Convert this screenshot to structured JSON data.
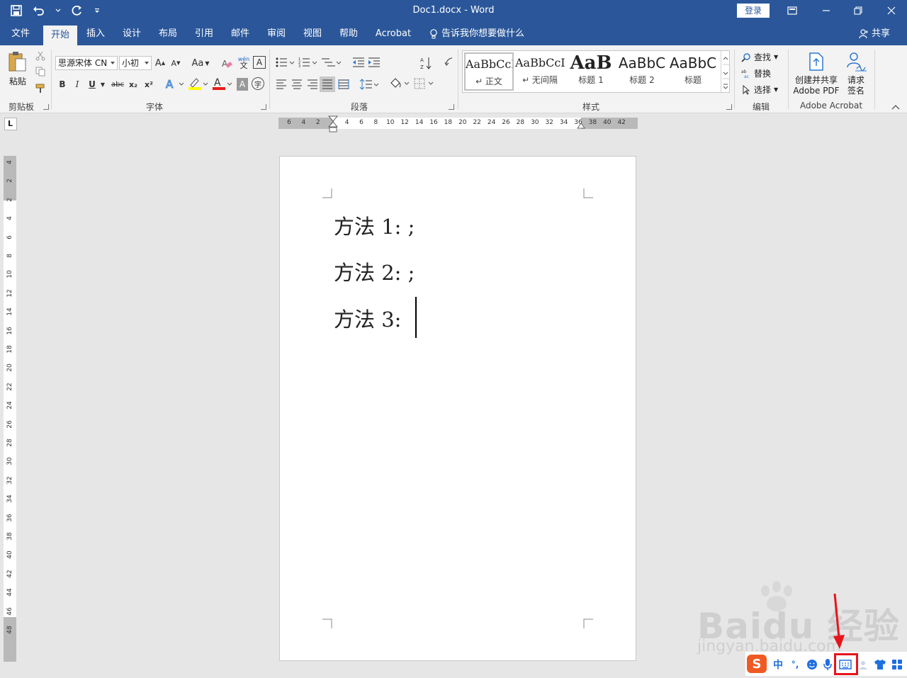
{
  "window": {
    "title": "Doc1.docx  -  Word",
    "login": "登录"
  },
  "tabs": [
    {
      "label": "文件"
    },
    {
      "label": "开始"
    },
    {
      "label": "插入"
    },
    {
      "label": "设计"
    },
    {
      "label": "布局"
    },
    {
      "label": "引用"
    },
    {
      "label": "邮件"
    },
    {
      "label": "审阅"
    },
    {
      "label": "视图"
    },
    {
      "label": "帮助"
    },
    {
      "label": "Acrobat"
    }
  ],
  "tellme": "告诉我你想要做什么",
  "share": "共享",
  "ribbon": {
    "clipboard": {
      "paste": "粘贴",
      "label": "剪贴板"
    },
    "font": {
      "name": "思源宋体 CN",
      "size": "小初",
      "label": "字体",
      "aa": "Aa",
      "bold": "B",
      "italic": "I",
      "underline": "U",
      "strike": "abc",
      "sub": "x₂",
      "sup": "x²",
      "wen": "wén",
      "a": "A"
    },
    "paragraph": {
      "label": "段落"
    },
    "styles": {
      "label": "样式",
      "items": [
        {
          "sample": "AaBbCcI",
          "name": "↵ 正文"
        },
        {
          "sample": "AaBbCcI",
          "name": "↵ 无间隔"
        },
        {
          "sample": "AaB",
          "name": "标题 1"
        },
        {
          "sample": "AaBbC",
          "name": "标题 2"
        },
        {
          "sample": "AaBbC",
          "name": "标题"
        }
      ]
    },
    "editing": {
      "find": "查找",
      "replace": "替换",
      "select": "选择",
      "label": "编辑"
    },
    "acrobat": {
      "create_l1": "创建并共享",
      "create_l2": "Adobe PDF",
      "sign_l1": "请求",
      "sign_l2": "签名",
      "label": "Adobe Acrobat"
    }
  },
  "ruler": {
    "h_ticks": [
      "6",
      "4",
      "2",
      "2",
      "4",
      "6",
      "8",
      "10",
      "12",
      "14",
      "16",
      "18",
      "20",
      "22",
      "24",
      "26",
      "28",
      "30",
      "32",
      "34",
      "36",
      "38",
      "40",
      "42"
    ],
    "v_ticks": [
      "4",
      "2",
      "2",
      "4",
      "6",
      "8",
      "10",
      "12",
      "14",
      "16",
      "18",
      "20",
      "22",
      "24",
      "26",
      "28",
      "30",
      "32",
      "34",
      "36",
      "38",
      "40",
      "42",
      "44",
      "46",
      "48"
    ],
    "tab_selector": "L"
  },
  "document": {
    "lines": [
      "方法 1: ;",
      "方法 2: ;",
      "方法 3:"
    ]
  },
  "watermark": {
    "main": "Baidu 经验",
    "sub": "jingyan.baidu.com"
  },
  "ime": {
    "logo": "S",
    "lang": "中",
    "punct": "°,"
  }
}
